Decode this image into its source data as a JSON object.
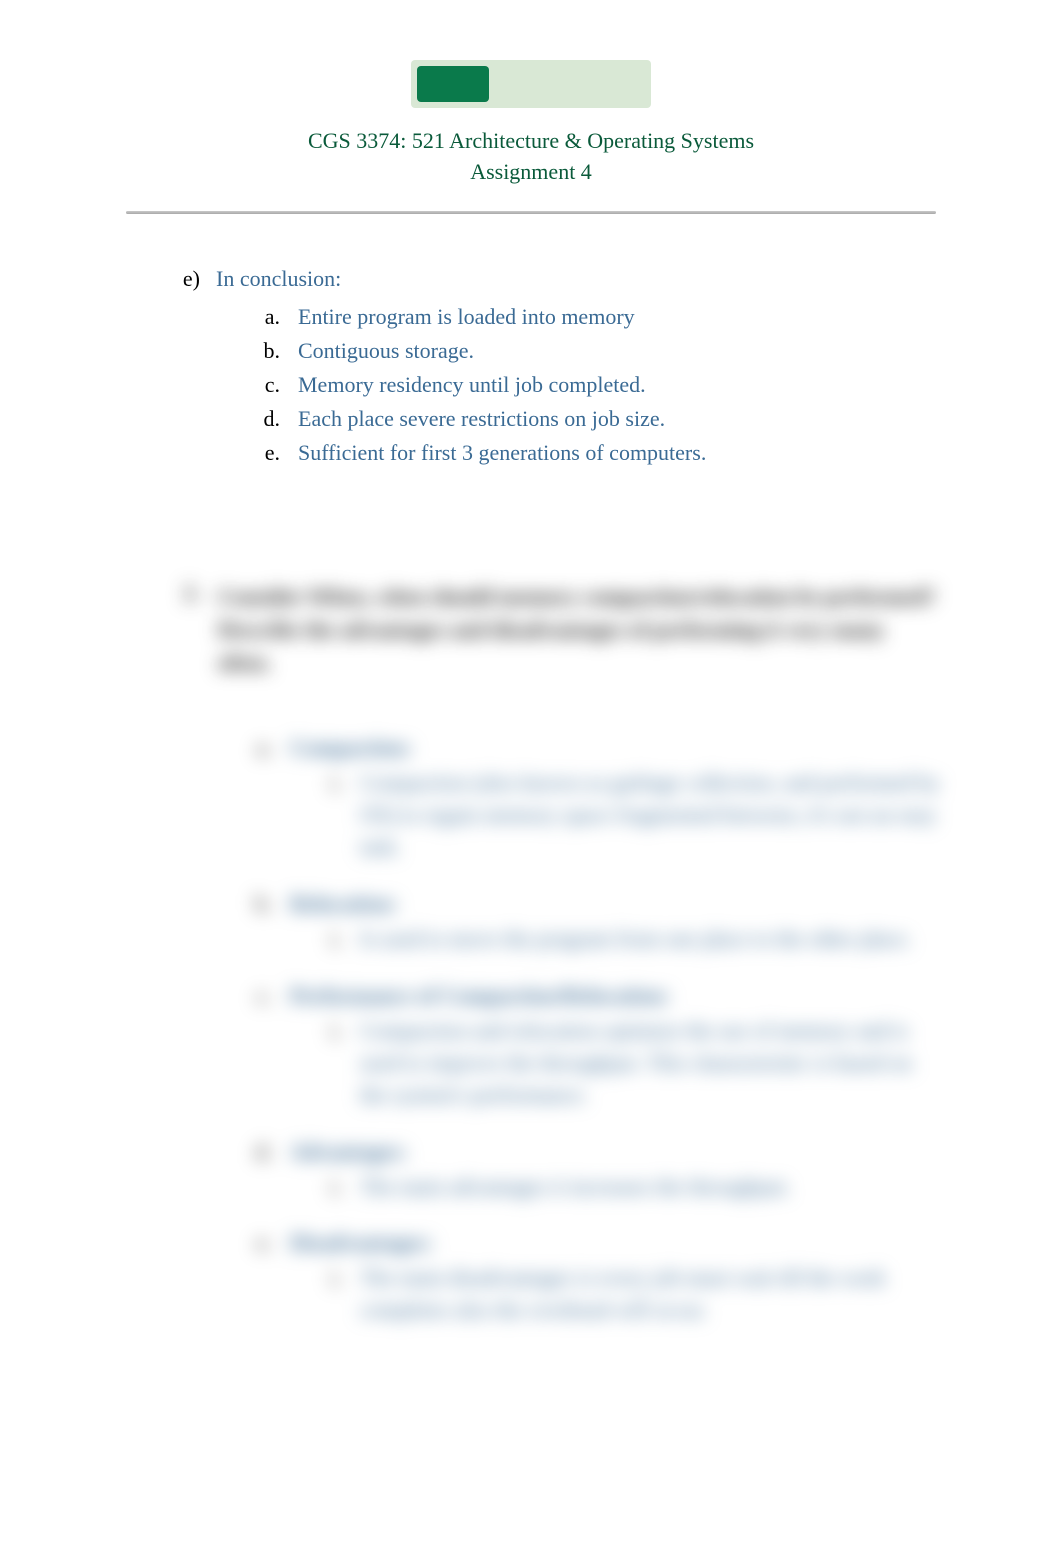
{
  "header": {
    "course_title": "CGS 3374: 521 Architecture & Operating Systems",
    "assignment_title": "Assignment 4"
  },
  "visible": {
    "e_marker": "e)",
    "e_label": "In conclusion:",
    "items": [
      {
        "marker": "a.",
        "text": "Entire program is loaded into memory"
      },
      {
        "marker": "b.",
        "text": "Contiguous storage."
      },
      {
        "marker": "c.",
        "text": "Memory residency until job completed."
      },
      {
        "marker": "d.",
        "text": "Each place severe restrictions on job size."
      },
      {
        "marker": "e.",
        "text": "Sufficient for first 3 generations of computers."
      }
    ]
  },
  "blurred": {
    "q_marker": "2.",
    "q_text": "Consider When, when should memory compaction/relocation be performed? Describe the advantages and disadvantages of performing it very many often.",
    "sections": [
      {
        "marker": "a.",
        "head": "Compaction:",
        "body_marker": "i.",
        "body": "Compaction (also known as garbage collection, and performed by OS) to regain memory space fragmented between, it's not an easy task."
      },
      {
        "marker": "b.",
        "head": "Relocation:",
        "body_marker": "i.",
        "body": "Is used to move the program from one place to the other place."
      },
      {
        "marker": "c.",
        "head": "Performance of Compaction/Relocation:",
        "body_marker": "i.",
        "body": "Compaction and relocation optimize the use of memory and is used to improve the throughput. This characteristic is based on the system's performance."
      },
      {
        "marker": "d.",
        "head": "Advantages:",
        "body_marker": "i.",
        "body": "The main advantages it increases the throughput."
      },
      {
        "marker": "e.",
        "head": "Disadvantages:",
        "body_marker": "i.",
        "body": "The main disadvantages is every job must wait till the work completes also the overhead will occur."
      }
    ]
  }
}
